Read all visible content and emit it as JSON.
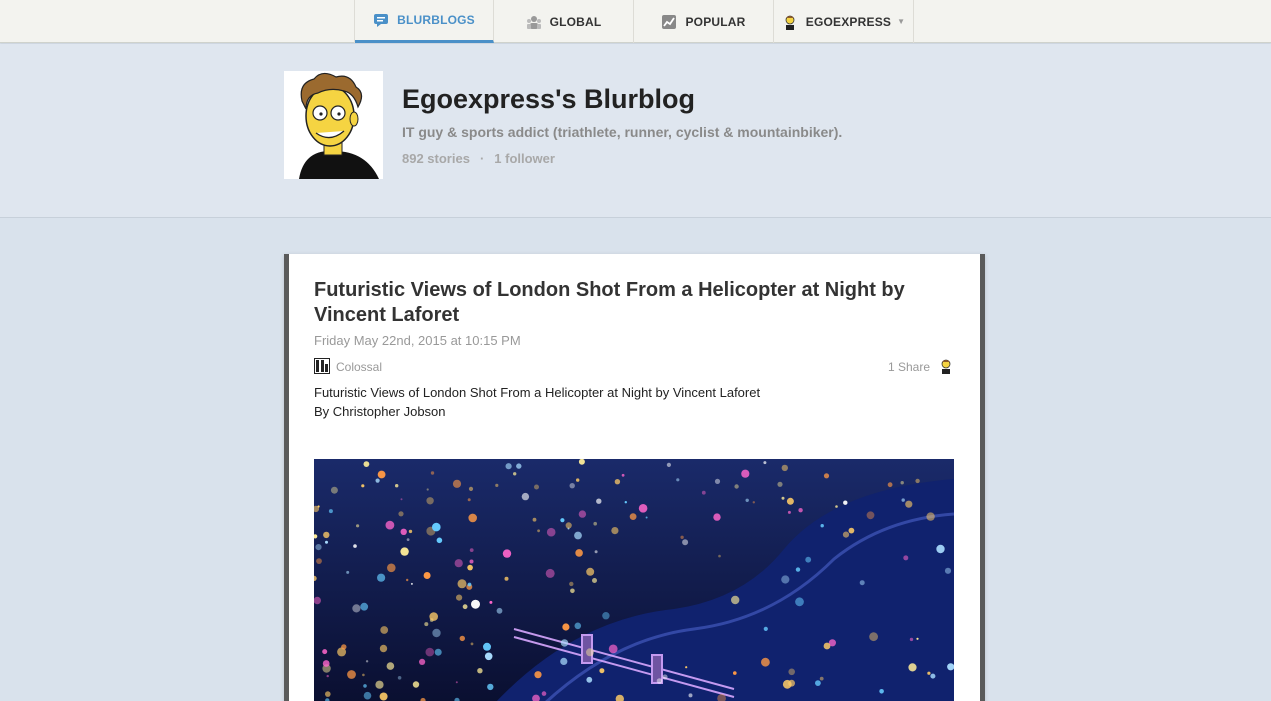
{
  "nav": {
    "tabs": [
      {
        "label": "BLURBLOGS",
        "icon": "speech-bubble-icon",
        "active": true
      },
      {
        "label": "GLOBAL",
        "icon": "people-icon",
        "active": false
      },
      {
        "label": "POPULAR",
        "icon": "trend-chart-icon",
        "active": false
      },
      {
        "label": "EGOEXPRESS",
        "icon": "user-avatar-icon",
        "active": false
      }
    ],
    "accent_color": "#4a90c8"
  },
  "profile": {
    "title": "Egoexpress's Blurblog",
    "description": "IT guy & sports addict (triathlete, runner, cyclist & mountainbiker).",
    "stories": "892 stories",
    "separator": "·",
    "followers": "1 follower"
  },
  "story": {
    "title": "Futuristic Views of London Shot From a Helicopter at Night by Vincent Laforet",
    "date": "Friday May 22nd, 2015 at 10:15 PM",
    "feed_name": "Colossal",
    "shares": "1 Share",
    "body_line1": "Futuristic Views of London Shot From a Helicopter at Night by Vincent Laforet",
    "body_line2": "By Christopher Jobson"
  }
}
